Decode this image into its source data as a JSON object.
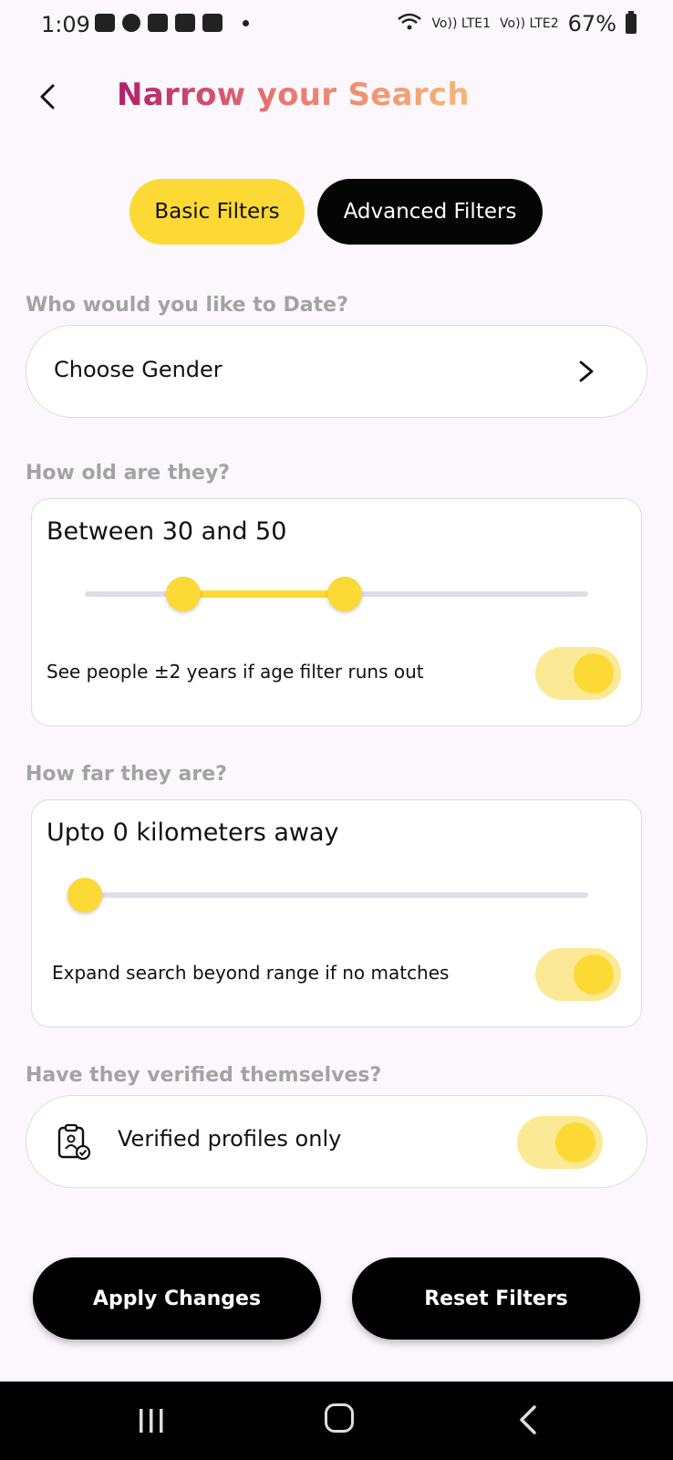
{
  "status_bar": {
    "time": "1:09",
    "network1": "Vo)) LTE1",
    "network2": "Vo)) LTE2",
    "battery": "67%"
  },
  "header": {
    "title": "Narrow your Search"
  },
  "tabs": {
    "basic": "Basic Filters",
    "advanced": "Advanced Filters",
    "active": "basic"
  },
  "gender": {
    "question": "Who would you like to Date?",
    "label": "Choose Gender"
  },
  "age": {
    "question": "How old are they?",
    "summary": "Between 30 and 50",
    "toggle_label": "See people ±2 years if age filter runs out",
    "toggle_on": true
  },
  "distance": {
    "question": "How far they are?",
    "summary": "Upto 0 kilometers away",
    "toggle_label": "Expand search beyond range if no matches",
    "toggle_on": true
  },
  "verification": {
    "question": "Have they verified themselves?",
    "label": "Verified profiles only",
    "toggle_on": true
  },
  "buttons": {
    "apply": "Apply Changes",
    "reset": "Reset Filters"
  },
  "colors": {
    "accent": "#fcd934",
    "toggle_track": "#fbe995",
    "title_gradient_start": "#b01f6a",
    "title_gradient_end": "#f6b777"
  }
}
